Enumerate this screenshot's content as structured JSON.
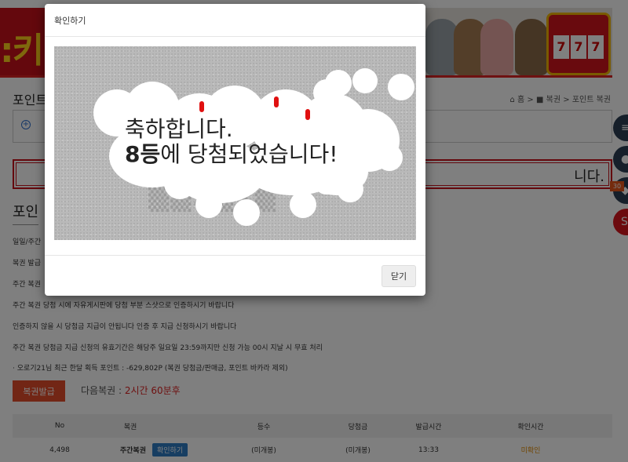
{
  "header": {
    "logo_text": ":키"
  },
  "breadcrumb": {
    "home": "홈",
    "lottery": "복권",
    "current": "포인트 복권",
    "separator": ">"
  },
  "section": {
    "title": "포인트"
  },
  "notice": {
    "tail": "니다."
  },
  "lottery_section": {
    "title": "포인"
  },
  "info_lines": [
    "일일/주간",
    "복권 발급",
    "주간 복권",
    "주간 복권 당첨 시에 자유게시판에 당첨 부분 스샷으로 인증하시기 바랍니다",
    "인증하지 않을 시 당첨금 지급이 안됩니다 인증 후 지급 신청하시기 바랍니다",
    "주간 복권 당첨금 지급 신청의 유효기간은 해당주 일요일 23:59까지만 신청 가능 00시 지날 시 무효 처리",
    "· 오로기21님 최근 한달 획득 포인트 : -629,802P (복권 당첨금/판매금, 포인트 바카라 제외)"
  ],
  "issue_button": "복권발급",
  "next_lottery": {
    "label": "다음복권 : ",
    "time": "2시간 60분후"
  },
  "table": {
    "headers": [
      "No",
      "복권",
      "등수",
      "당첨금",
      "발급시간",
      "확인시간"
    ],
    "rows": [
      {
        "no": "4,498",
        "name": "주간복권",
        "confirm_label": "확인하기",
        "rank": "(미개봉)",
        "prize": "(미개봉)",
        "issued": "13:33",
        "checked": "미확인"
      }
    ]
  },
  "side_badge": "30",
  "modal": {
    "title": "확인하기",
    "win_line1": "축하합니다.",
    "win_rank": "8등",
    "win_line2_rest": "에 당첨되었습니다!",
    "close_label": "닫기"
  },
  "colors": {
    "brand_red": "#c8101b",
    "issue_button": "#e44d2a",
    "confirm_button": "#2f7dc4"
  }
}
